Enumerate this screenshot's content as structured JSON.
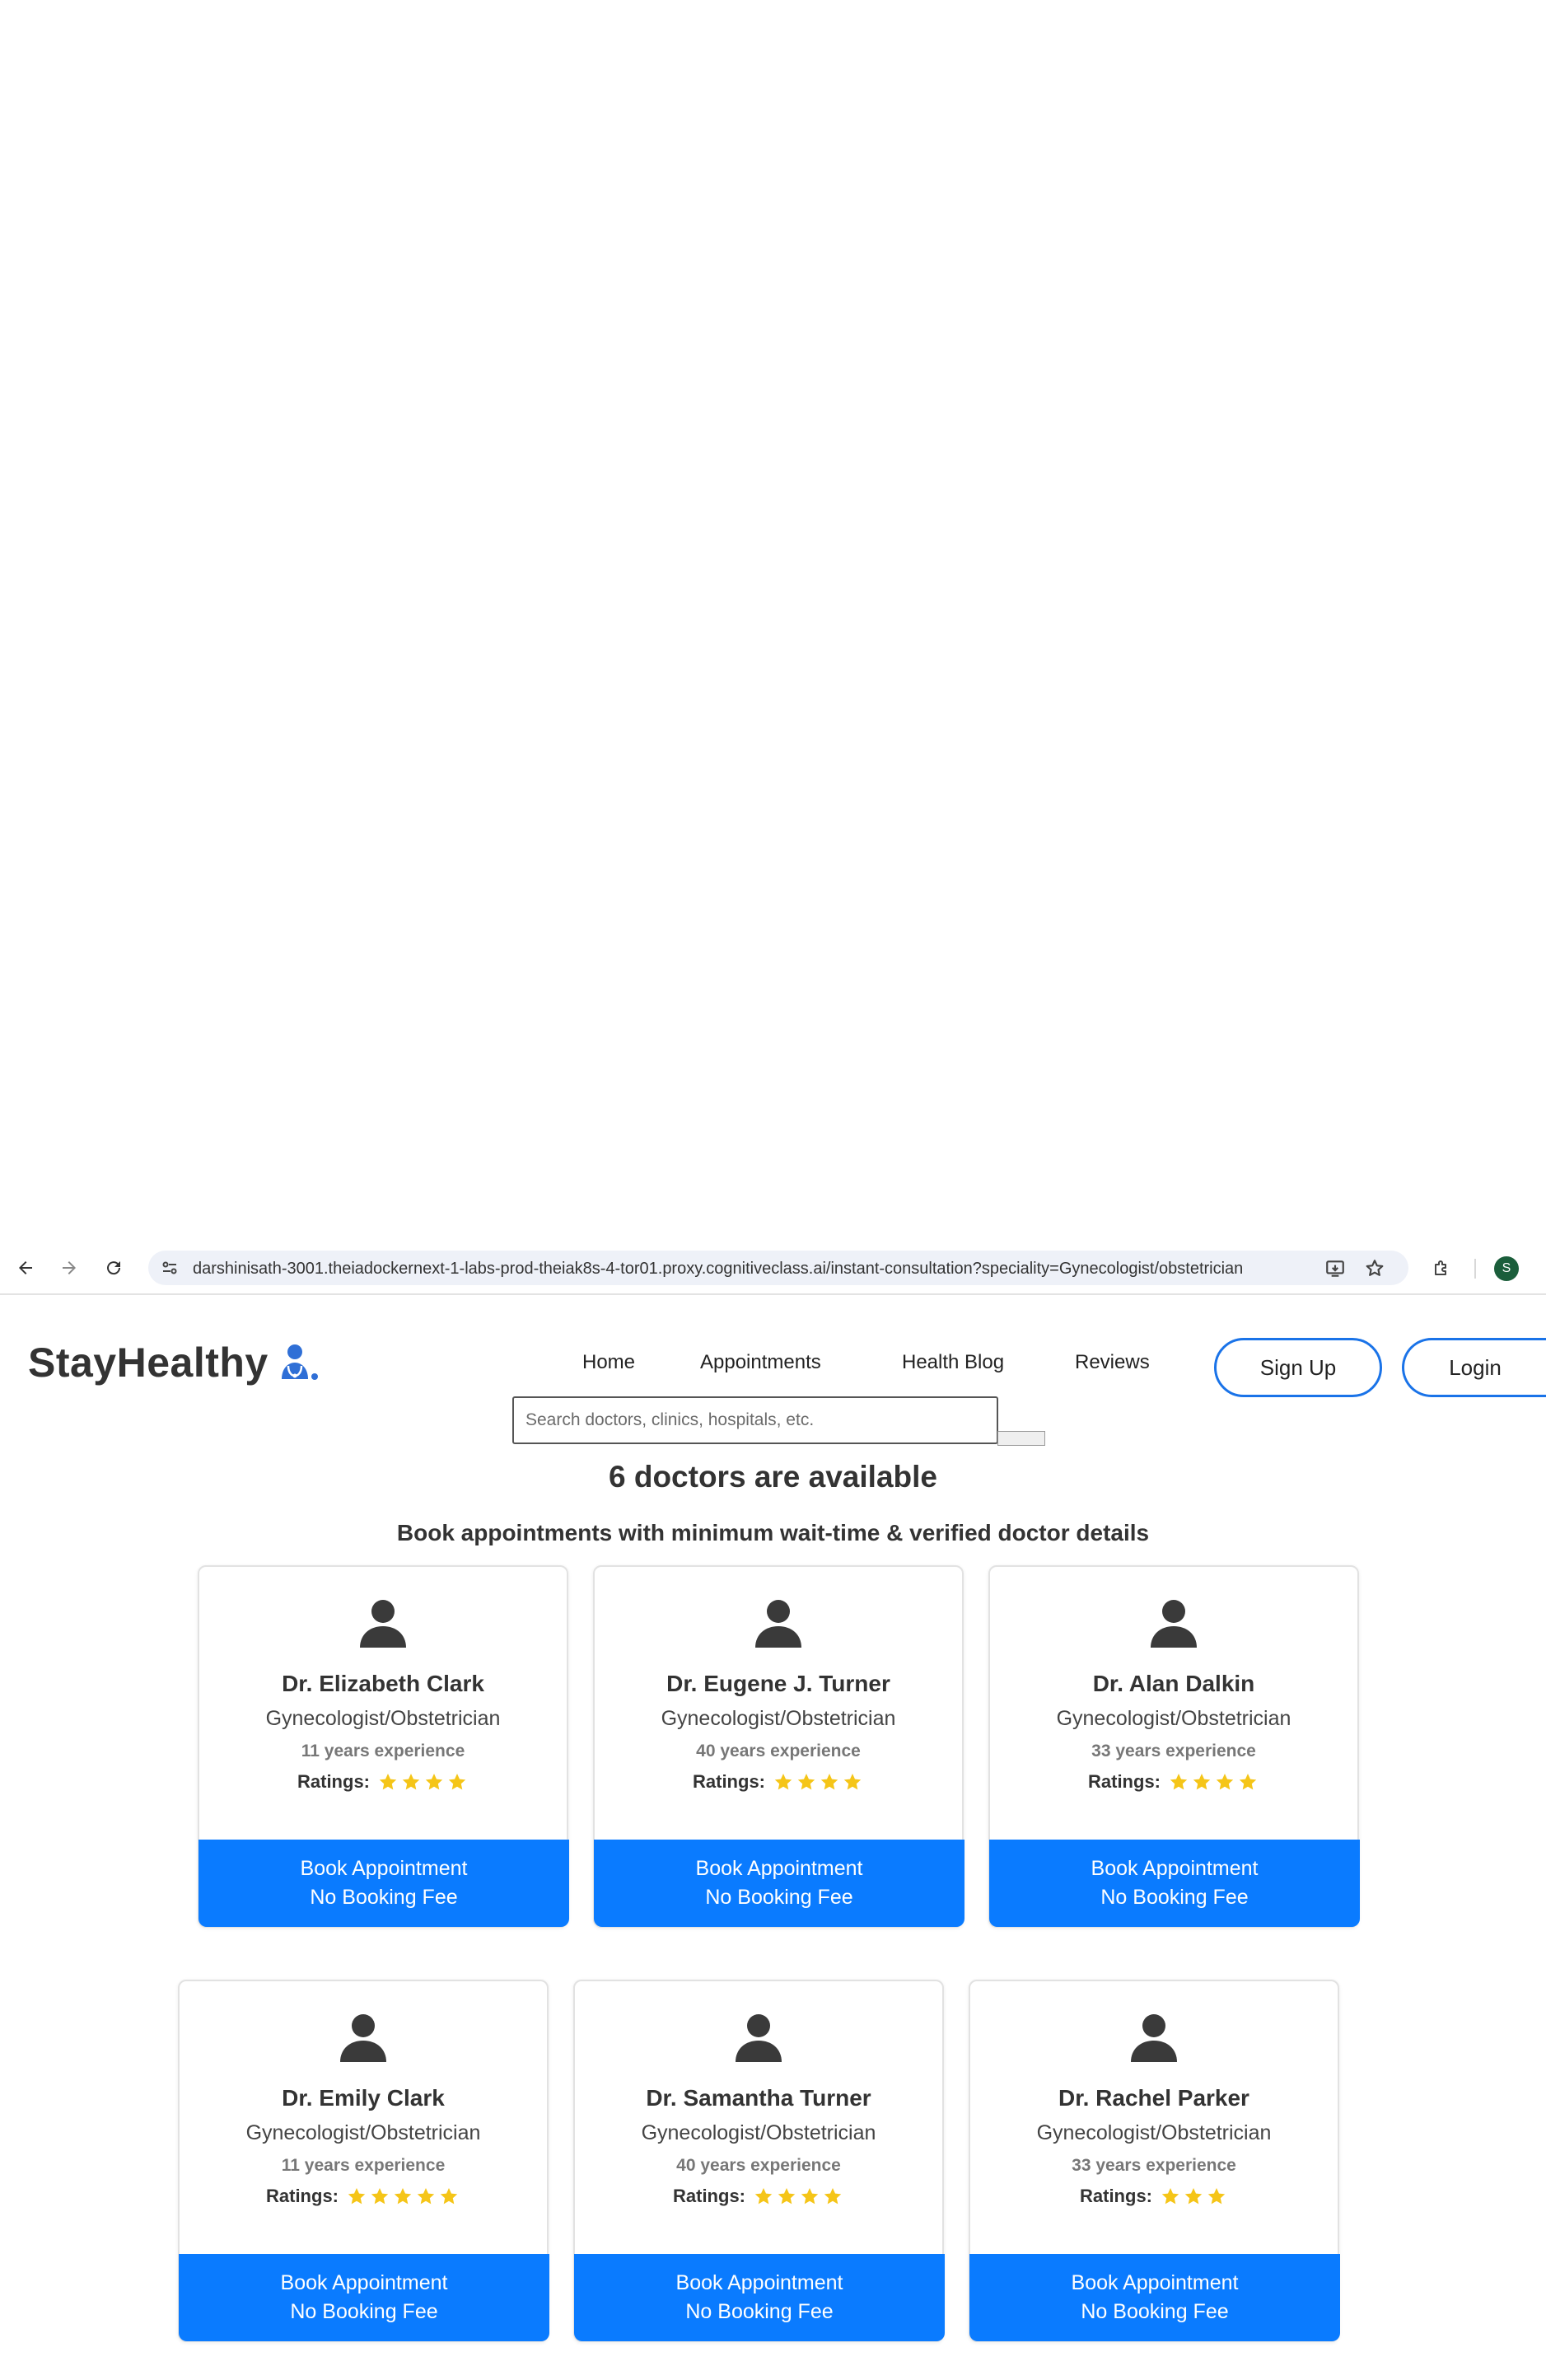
{
  "browser": {
    "url": "darshinisath-3001.theiadockernext-1-labs-prod-theiak8s-4-tor01.proxy.cognitiveclass.ai/instant-consultation?speciality=Gynecologist/obstetrician",
    "profile_initial": "S"
  },
  "header": {
    "logo_text": "StayHealthy",
    "nav": [
      "Home",
      "Appointments",
      "Health Blog",
      "Reviews"
    ],
    "sign_up": "Sign Up",
    "login": "Login",
    "accent_color": "#1a73e8"
  },
  "search": {
    "placeholder": "Search doctors, clinics, hospitals, etc."
  },
  "results": {
    "count_heading": "6 doctors are available",
    "subheading": "Book appointments with minimum wait-time & verified doctor details"
  },
  "doctors": [
    {
      "name": "Dr. Elizabeth Clark",
      "speciality": "Gynecologist/Obstetrician",
      "experience": "11 years experience",
      "ratings_label": "Ratings:",
      "stars": 4,
      "book_label": "Book Appointment",
      "fee_label": "No Booking Fee"
    },
    {
      "name": "Dr. Eugene J. Turner",
      "speciality": "Gynecologist/Obstetrician",
      "experience": "40 years experience",
      "ratings_label": "Ratings:",
      "stars": 4,
      "book_label": "Book Appointment",
      "fee_label": "No Booking Fee"
    },
    {
      "name": "Dr. Alan Dalkin",
      "speciality": "Gynecologist/Obstetrician",
      "experience": "33 years experience",
      "ratings_label": "Ratings:",
      "stars": 4,
      "book_label": "Book Appointment",
      "fee_label": "No Booking Fee"
    },
    {
      "name": "Dr. Emily Clark",
      "speciality": "Gynecologist/Obstetrician",
      "experience": "11 years experience",
      "ratings_label": "Ratings:",
      "stars": 5,
      "book_label": "Book Appointment",
      "fee_label": "No Booking Fee"
    },
    {
      "name": "Dr. Samantha Turner",
      "speciality": "Gynecologist/Obstetrician",
      "experience": "40 years experience",
      "ratings_label": "Ratings:",
      "stars": 4,
      "book_label": "Book Appointment",
      "fee_label": "No Booking Fee"
    },
    {
      "name": "Dr. Rachel Parker",
      "speciality": "Gynecologist/Obstetrician",
      "experience": "33 years experience",
      "ratings_label": "Ratings:",
      "stars": 3,
      "book_label": "Book Appointment",
      "fee_label": "No Booking Fee"
    }
  ],
  "colors": {
    "button_blue": "#0a7bff",
    "star_yellow": "#f5c518"
  }
}
